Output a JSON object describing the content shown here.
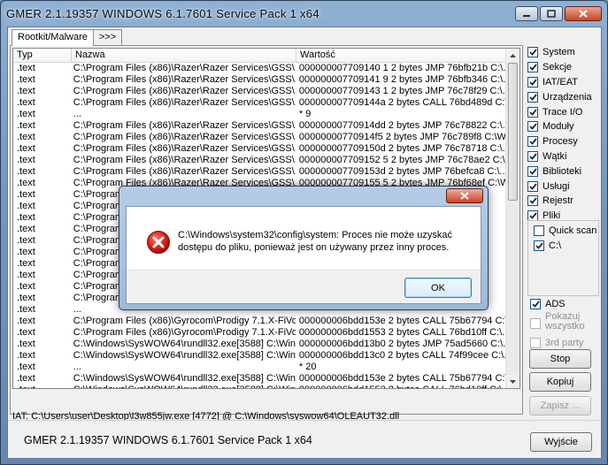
{
  "window": {
    "title": "GMER 2.1.19357     WINDOWS 6.1.7601 Service Pack 1 x64"
  },
  "tabs": [
    {
      "label": "Rootkit/Malware"
    },
    {
      "label": ">>>"
    }
  ],
  "list": {
    "columns": [
      "Typ",
      "Nazwa",
      "Wartość"
    ],
    "rows": [
      [
        ".text",
        "C:\\Program Files (x86)\\Razer\\Razer Services\\GSS\\...",
        "000000007709140 1 2 bytes JMP 76bfb21b C:\\..."
      ],
      [
        ".text",
        "C:\\Program Files (x86)\\Razer\\Razer Services\\GSS\\...",
        "000000007709141 9 2 bytes JMP 76bfb346 C:\\..."
      ],
      [
        ".text",
        "C:\\Program Files (x86)\\Razer\\Razer Services\\GSS\\...",
        "000000007709143 1 2 bytes JMP 76c78f29 C:\\..."
      ],
      [
        ".text",
        "C:\\Program Files (x86)\\Razer\\Razer Services\\GSS\\...",
        "000000007709144a 2 bytes CALL 76bd489d C:\\..."
      ],
      [
        ".text",
        "...",
        "* 9"
      ],
      [
        ".text",
        "C:\\Program Files (x86)\\Razer\\Razer Services\\GSS\\...",
        "00000000770914dd 2 bytes JMP 76c78822 C:\\..."
      ],
      [
        ".text",
        "C:\\Program Files (x86)\\Razer\\Razer Services\\GSS\\...",
        "00000000770914f5 2 bytes JMP 76c789f8 C:\\W..."
      ],
      [
        ".text",
        "C:\\Program Files (x86)\\Razer\\Razer Services\\GSS\\...",
        "000000007709150d 2 bytes JMP 76c78718 C:\\..."
      ],
      [
        ".text",
        "C:\\Program Files (x86)\\Razer\\Razer Services\\GSS\\...",
        "000000007709152 5 2 bytes JMP 76c78ae2 C:\\..."
      ],
      [
        ".text",
        "C:\\Program Files (x86)\\Razer\\Razer Services\\GSS\\...",
        "000000007709153d 2 bytes JMP 76befca8 C:\\..."
      ],
      [
        ".text",
        "C:\\Program Files (x86)\\Razer\\Razer Services\\GSS\\...",
        "000000007709155 5 2 bytes JMP 76bf68ef C:\\W..."
      ],
      [
        ".text",
        "C:\\Program",
        ""
      ],
      [
        ".text",
        "C:\\Program",
        ""
      ],
      [
        ".text",
        "C:\\Program",
        ""
      ],
      [
        ".text",
        "C:\\Program",
        ""
      ],
      [
        ".text",
        "C:\\Program",
        ""
      ],
      [
        ".text",
        "C:\\Program",
        ""
      ],
      [
        ".text",
        "C:\\Program",
        ""
      ],
      [
        ".text",
        "C:\\Program",
        ""
      ],
      [
        ".text",
        "C:\\Program",
        ""
      ],
      [
        ".text",
        "C:\\Program",
        ""
      ],
      [
        ".text",
        "...",
        ""
      ],
      [
        ".text",
        "C:\\Program Files (x86)\\Gyrocom\\Prodigy 7.1.X-FiVol...",
        "000000006bdd153e 2 bytes CALL 75b67794 C:\\..."
      ],
      [
        ".text",
        "C:\\Program Files (x86)\\Gyrocom\\Prodigy 7.1.X-FiVol...",
        "000000006bdd1553 2 bytes CALL 76bd10ff C:\\..."
      ],
      [
        ".text",
        "C:\\Windows\\SysWOW64\\rundll32.exe[3588] C:\\Win...",
        "000000006bdd13b0 2 bytes JMP 75ad5660 C:\\..."
      ],
      [
        ".text",
        "C:\\Windows\\SysWOW64\\rundll32.exe[3588] C:\\Win...",
        "000000006bdd13c0 2 bytes CALL 74f99cee C:\\..."
      ],
      [
        ".text",
        "...",
        "* 20"
      ],
      [
        ".text",
        "C:\\Windows\\SysWOW64\\rundll32.exe[3588] C:\\Win...",
        "000000006bdd153e 2 bytes CALL 75b67794 C:\\..."
      ],
      [
        ".text",
        "C:\\Windows\\SysWOW64\\rundll32.exe[3588] C:\\Win...",
        "000000006bdd1553 2 bytes CALL 76bd10ff C:\\..."
      ]
    ]
  },
  "status_line": "IAT: C:\\Users\\user\\Desktop\\l3w855jw.exe [4772] @ C:\\Windows\\syswow64\\OLEAUT32.dll",
  "options": [
    {
      "label": "System",
      "checked": true
    },
    {
      "label": "Sekcje",
      "checked": true
    },
    {
      "label": "IAT/EAT",
      "checked": true
    },
    {
      "label": "Urządzenia",
      "checked": true
    },
    {
      "label": "Trace I/O",
      "checked": true
    },
    {
      "label": "Moduły",
      "checked": true
    },
    {
      "label": "Procesy",
      "checked": true
    },
    {
      "label": "Wątki",
      "checked": true
    },
    {
      "label": "Biblioteki",
      "checked": true
    },
    {
      "label": "Usługi",
      "checked": true
    },
    {
      "label": "Rejestr",
      "checked": true
    },
    {
      "label": "Pliki",
      "checked": true
    }
  ],
  "files_group": [
    {
      "label": "Quick scan",
      "checked": false
    },
    {
      "label": "C:\\",
      "checked": true
    }
  ],
  "ads": {
    "label": "ADS",
    "checked": true
  },
  "show_all": {
    "label": "Pokazuj wszystko"
  },
  "third_party": {
    "label": "3rd party"
  },
  "buttons": {
    "stop": "Stop",
    "copy": "Kopiuj",
    "save": "Zapisz ...",
    "exit": "Wyjście"
  },
  "footer_title": "GMER 2.1.19357     WINDOWS 6.1.7601 Service Pack 1 x64",
  "dialog": {
    "message": "C:\\Windows\\system32\\config\\system: Proces nie może uzyskać dostępu do pliku, ponieważ jest on używany przez inny proces.",
    "ok_label": "OK",
    "icon": "error-icon"
  },
  "colors": {
    "titlebar": "#7598c0",
    "error_red": "#c8102e"
  }
}
